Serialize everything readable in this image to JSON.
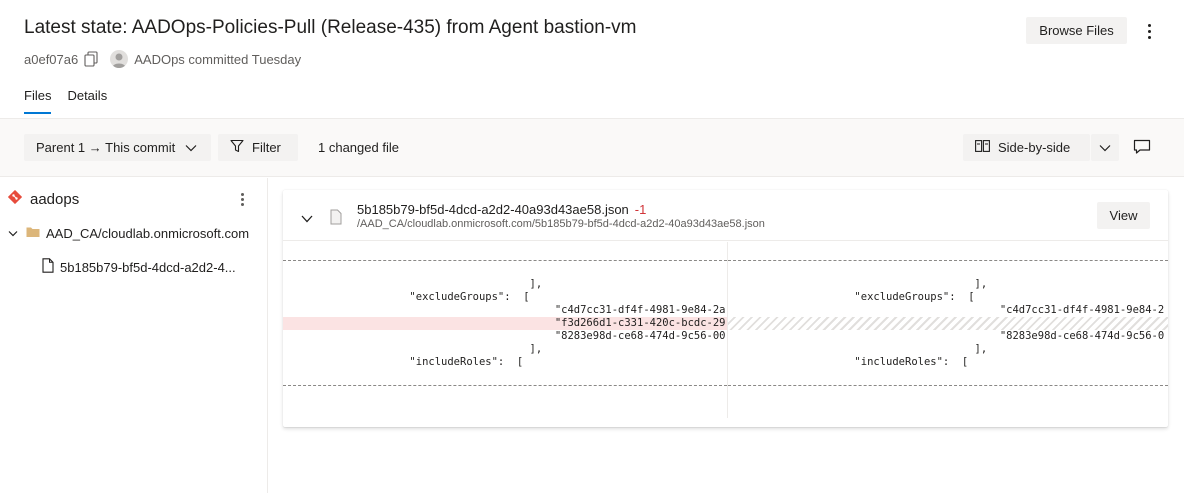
{
  "header": {
    "title": "Latest state: AADOps-Policies-Pull (Release-435) from Agent bastion-vm",
    "commit_id": "a0ef07a6",
    "committed_text": "AADOps committed Tuesday",
    "browse_files_label": "Browse Files"
  },
  "tabs": [
    {
      "label": "Files",
      "active": true
    },
    {
      "label": "Details",
      "active": false
    }
  ],
  "toolbar": {
    "parent_label": "Parent 1 → This commit",
    "filter_label": "Filter",
    "changed_files": "1 changed file",
    "view_mode_label": "Side-by-side"
  },
  "sidebar": {
    "repo_name": "aadops",
    "folder": "AAD_CA/cloudlab.onmicrosoft.com",
    "file": "5b185b79-bf5d-4dcd-a2d2-4..."
  },
  "diff": {
    "file_name": "5b185b79-bf5d-4dcd-a2d2-40a93d43ae58.json",
    "change_count": "-1",
    "file_path": "/AAD_CA/cloudlab.onmicrosoft.com/5b185b79-bf5d-4dcd-a2d2-40a93d43ae58.json",
    "view_label": "View",
    "left_lines": [
      {
        "text": "                                       ],",
        "type": "context"
      },
      {
        "text": "                    \"excludeGroups\":  [",
        "type": "context"
      },
      {
        "text": "                                           \"c4d7cc31-df4f-4981-9e84-2a",
        "type": "context"
      },
      {
        "text": "                                           \"f3d266d1-c331-420c-bcdc-29",
        "type": "removed"
      },
      {
        "text": "                                           \"8283e98d-ce68-474d-9c56-00",
        "type": "context"
      },
      {
        "text": "                                       ],",
        "type": "context"
      },
      {
        "text": "                    \"includeRoles\":  [",
        "type": "context"
      }
    ],
    "right_lines": [
      {
        "text": "                                       ],",
        "type": "context"
      },
      {
        "text": "                    \"excludeGroups\":  [",
        "type": "context"
      },
      {
        "text": "                                           \"c4d7cc31-df4f-4981-9e84-2",
        "type": "context"
      },
      {
        "text": "",
        "type": "placeholder"
      },
      {
        "text": "                                           \"8283e98d-ce68-474d-9c56-0",
        "type": "context"
      },
      {
        "text": "                                       ],",
        "type": "context"
      },
      {
        "text": "                    \"includeRoles\":  [",
        "type": "context"
      }
    ]
  },
  "colors": {
    "accent": "#0078d4",
    "removed_bg": "#fbe3e3",
    "removed_count": "#d13438",
    "repo_icon": "#e74c3c",
    "folder_icon": "#dcb67a"
  }
}
